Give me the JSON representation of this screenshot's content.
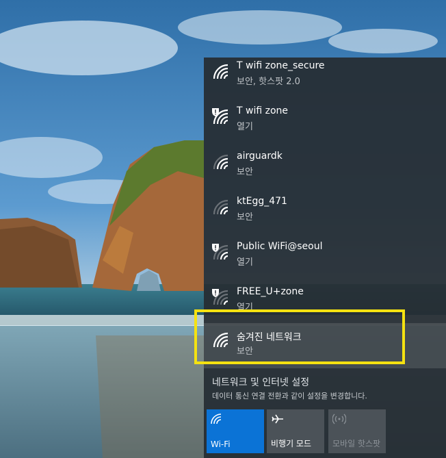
{
  "networks": [
    {
      "name": "T wifi zone_secure",
      "status": "보안, 핫스팟 2.0",
      "icon": "wifi-icon",
      "shield": false,
      "highlighted": false
    },
    {
      "name": "T wifi zone",
      "status": "열기",
      "icon": "wifi-open-warning-icon",
      "shield": true,
      "highlighted": false
    },
    {
      "name": "airguardk",
      "status": "보안",
      "icon": "wifi-icon",
      "shield": false,
      "highlighted": false
    },
    {
      "name": "ktEgg_471",
      "status": "보안",
      "icon": "wifi-icon",
      "shield": false,
      "highlighted": false
    },
    {
      "name": "Public WiFi@seoul",
      "status": "열기",
      "icon": "wifi-open-warning-icon",
      "shield": true,
      "highlighted": false
    },
    {
      "name": "FREE_U+zone",
      "status": "열기",
      "icon": "wifi-open-warning-icon",
      "shield": true,
      "highlighted": false
    },
    {
      "name": "숨겨진 네트워크",
      "status": "보안",
      "icon": "wifi-icon",
      "shield": false,
      "highlighted": true
    }
  ],
  "settings": {
    "link": "네트워크 및 인터넷 설정",
    "description": "데이터 통신 연결 전환과 같이 설정을 변경합니다."
  },
  "quick_actions": {
    "wifi": {
      "label": "Wi-Fi",
      "icon": "wifi-icon",
      "active": true
    },
    "airplane": {
      "label": "비행기 모드",
      "icon": "airplane-icon",
      "active": false
    },
    "hotspot": {
      "label": "모바일 핫스팟",
      "icon": "hotspot-icon",
      "active": false
    }
  },
  "colors": {
    "accent": "#0b73d6",
    "highlight_box": "#f5e211",
    "flyout_bg": "#262c32"
  }
}
